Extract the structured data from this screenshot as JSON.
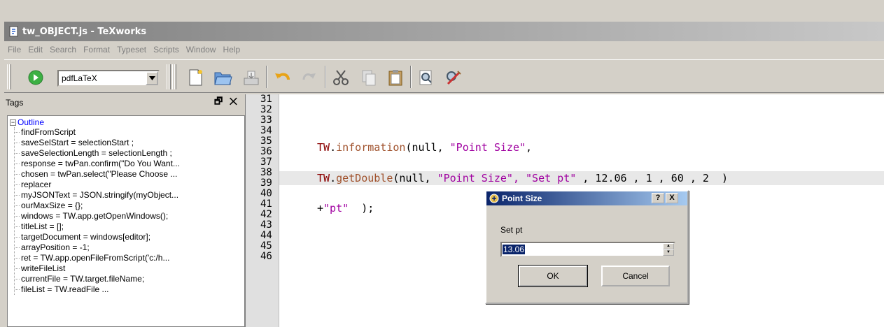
{
  "window": {
    "title": "tw_OBJECT.js - TeXworks"
  },
  "menu": [
    "File",
    "Edit",
    "Search",
    "Format",
    "Typeset",
    "Scripts",
    "Window",
    "Help"
  ],
  "toolbar": {
    "engine": "pdfLaTeX",
    "buttons": [
      "typeset-icon",
      "new-document-icon",
      "open-folder-icon",
      "save-icon",
      "undo-icon",
      "redo-icon",
      "cut-icon",
      "copy-icon",
      "paste-icon",
      "find-icon",
      "replace-icon"
    ]
  },
  "tags": {
    "title": "Tags",
    "controls": "🗗 ✕",
    "root": "Outline",
    "items": [
      "findFromScript",
      "saveSelStart = selectionStart ;",
      "saveSelectionLength = selectionLength ;",
      "response = twPan.confirm(\"Do You Want...",
      "chosen = twPan.select(\"Please Choose ...",
      "replacer",
      "myJSONText = JSON.stringify(myObject...",
      "ourMaxSize = {};",
      "windows = TW.app.getOpenWindows();",
      "titleList = [];",
      "targetDocument = windows[editor];",
      "arrayPosition = -1;",
      " ret = TW.app.openFileFromScript('c:/h...",
      "writeFileList",
      " currentFile = TW.target.fileName;",
      " fileList  = TW.readFile ..."
    ]
  },
  "editor": {
    "line_numbers": [
      "31",
      "32",
      "33",
      "34",
      "35",
      "36",
      "37",
      "38",
      "39",
      "40",
      "41",
      "42",
      "43",
      "44",
      "45",
      "46"
    ],
    "lines": {
      "l34": {
        "obj": "TW",
        "fn": "information",
        "args1": "(null, ",
        "s1": "\"Point Size\"",
        "rest": ","
      },
      "l36": {
        "obj": "TW",
        "fn": "getDouble",
        "args1": "(null, ",
        "s1": "\"Point Size\", \"Set pt\"",
        "rest": " , 12.06 , 1 , 60 , 2  )"
      },
      "l38": {
        "pre": "+",
        "s1": "\"pt\"",
        "rest": "  );"
      }
    }
  },
  "dialog": {
    "title": "Point Size",
    "help_label": "?",
    "close_label": "X",
    "label": "Set pt",
    "value": "13.06",
    "ok_label": "OK",
    "cancel_label": "Cancel"
  },
  "colors": {
    "selection": "#0a246a",
    "keyword": "#8b0000",
    "function": "#a0522d",
    "string": "#a000a0"
  }
}
